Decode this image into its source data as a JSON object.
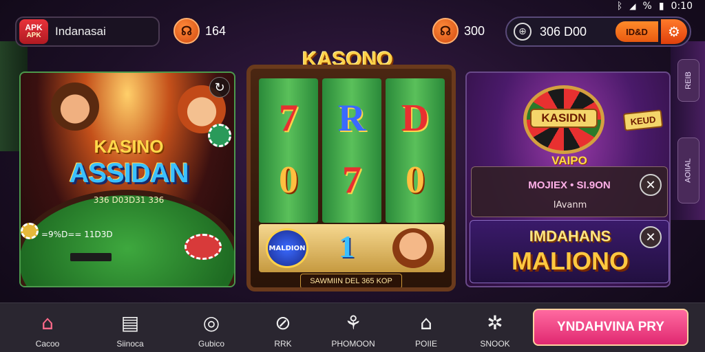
{
  "status_bar": {
    "icons": [
      "bluetooth-icon",
      "signal-icon",
      "battery-icon"
    ],
    "signal_text": "%",
    "time": "0:10"
  },
  "header": {
    "logo_text_top": "APK",
    "logo_text_bottom": "APK",
    "brand_name": "Indanasai",
    "coins_primary": "164",
    "coins_secondary": "300",
    "wallet_value": "306 D00",
    "wallet_button": "ID&D"
  },
  "left_panel": {
    "title_top": "KASINO",
    "title_main": "ASSIDAN",
    "subtitle": "336 D03D31 336",
    "row_text": "=9%D== 11D3D"
  },
  "mid_panel": {
    "title": "KASONO",
    "reels": [
      [
        "7",
        "0"
      ],
      [
        "R",
        "7"
      ],
      [
        "D",
        "0"
      ]
    ],
    "bottom_badge": "MALDION",
    "bottom_number": "1",
    "footer": "SAWMIIN DEL 365 KOP"
  },
  "right_panel": {
    "wheel_label": "KASIDN",
    "side_sign": "KEUD",
    "tag": "VAIPO",
    "promo_text": "MOJIEX • SI.9ON",
    "promo_sub": "IAvanm",
    "jackpot_line1": "IMDAHANS",
    "jackpot_line2": "MALIONO"
  },
  "side_tabs": [
    "REIB",
    "AOIIAL"
  ],
  "bottom_nav": {
    "items": [
      {
        "label": "Cacoo",
        "icon": "home-icon"
      },
      {
        "label": "Siinoca",
        "icon": "slot-machine-icon"
      },
      {
        "label": "Gubico",
        "icon": "dice-icon"
      },
      {
        "label": "RRK",
        "icon": "compass-icon"
      },
      {
        "label": "PHOMOON",
        "icon": "gift-icon"
      },
      {
        "label": "POIIE",
        "icon": "shop-icon"
      },
      {
        "label": "SNOOK",
        "icon": "gear-icon"
      }
    ],
    "play_button": "YNDAHVINA PRY"
  },
  "colors": {
    "accent": "#ff7a2a",
    "play": "#e02870",
    "nav_bg": "#2a2630"
  }
}
